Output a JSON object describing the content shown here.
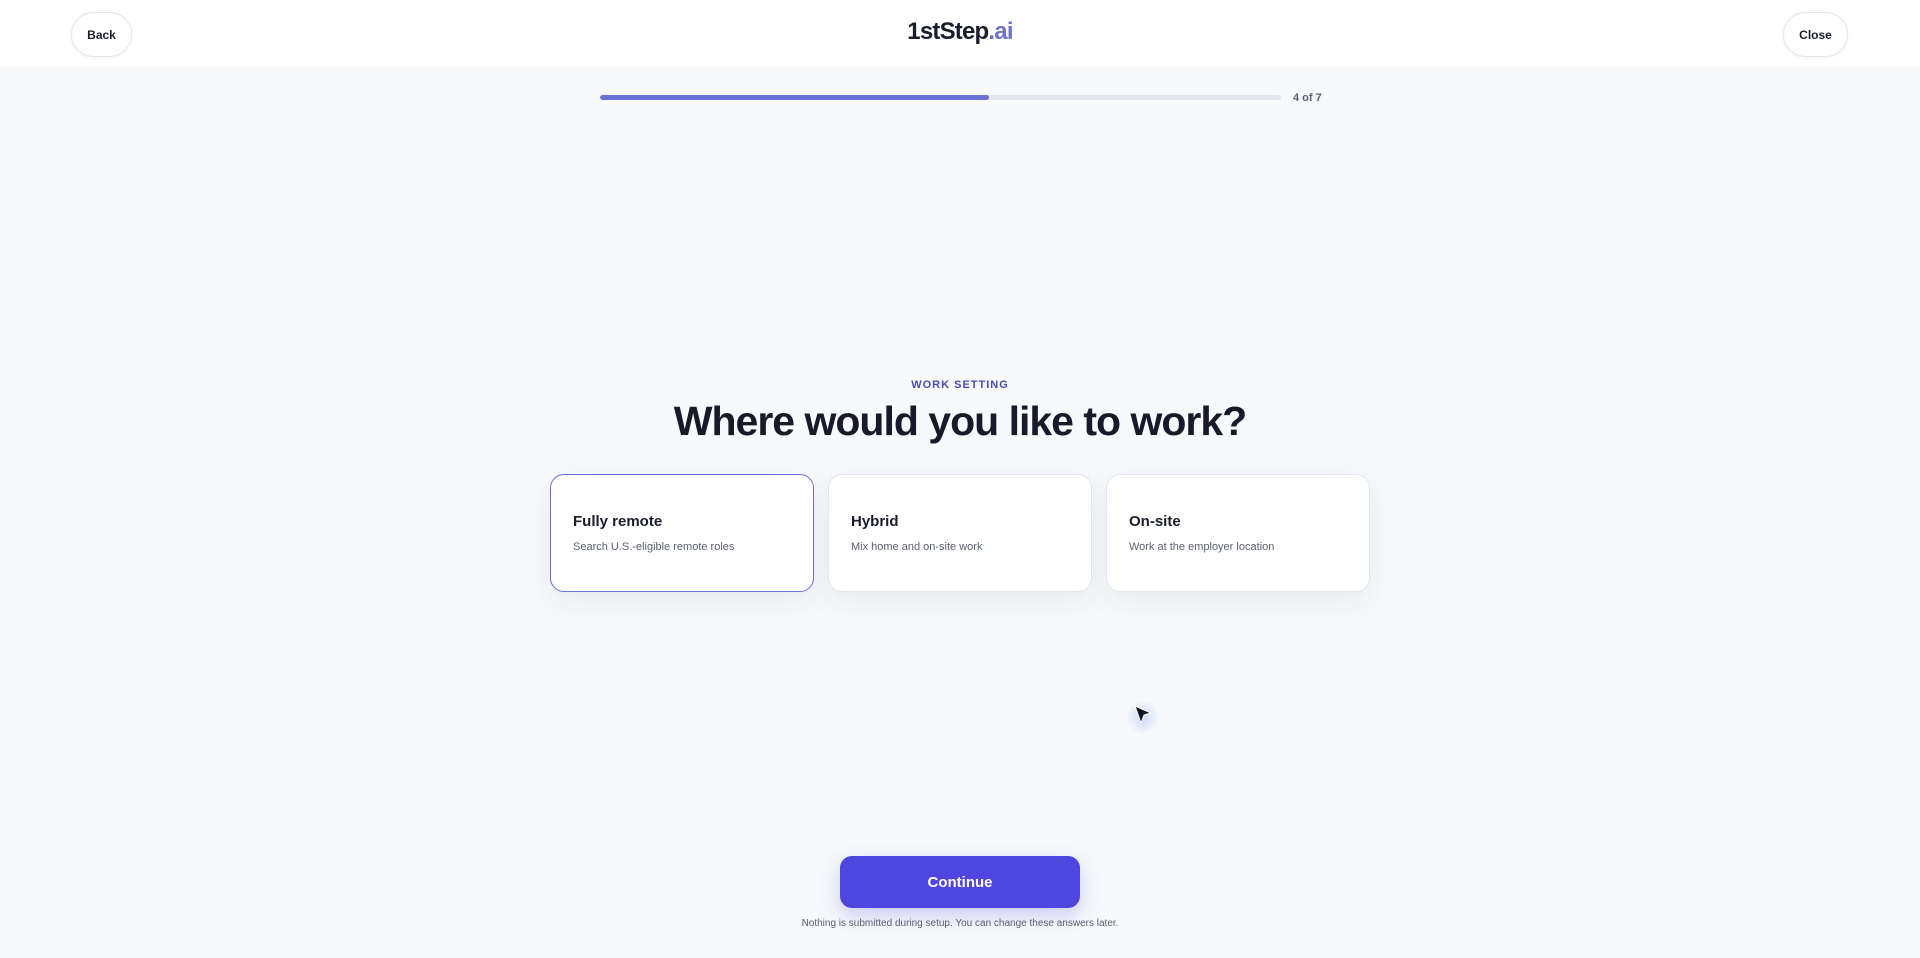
{
  "header": {
    "back_label": "Back",
    "close_label": "Close",
    "logo_main": "1stStep",
    "logo_accent": ".ai"
  },
  "progress": {
    "current": 4,
    "total": 7,
    "fraction": 0.571,
    "label": "4 of 7",
    "fill_color": "#6b72d6"
  },
  "step": {
    "eyebrow": "WORK SETTING",
    "question": "Where would you like to work?"
  },
  "options": [
    {
      "title": "Fully remote",
      "subtitle": "Search U.S.-eligible remote roles",
      "selected": true
    },
    {
      "title": "Hybrid",
      "subtitle": "Mix home and on-site work",
      "selected": false
    },
    {
      "title": "On-site",
      "subtitle": "Work at the employer location",
      "selected": false
    }
  ],
  "footer": {
    "continue_label": "Continue",
    "note": "Nothing is submitted during setup. You can change these answers later."
  },
  "colors": {
    "primary": "#4f46e0",
    "accent": "#6b72c8",
    "selected_border": "#6c6fd6"
  },
  "icons": {
    "cursor": "mouse-pointer-icon"
  }
}
